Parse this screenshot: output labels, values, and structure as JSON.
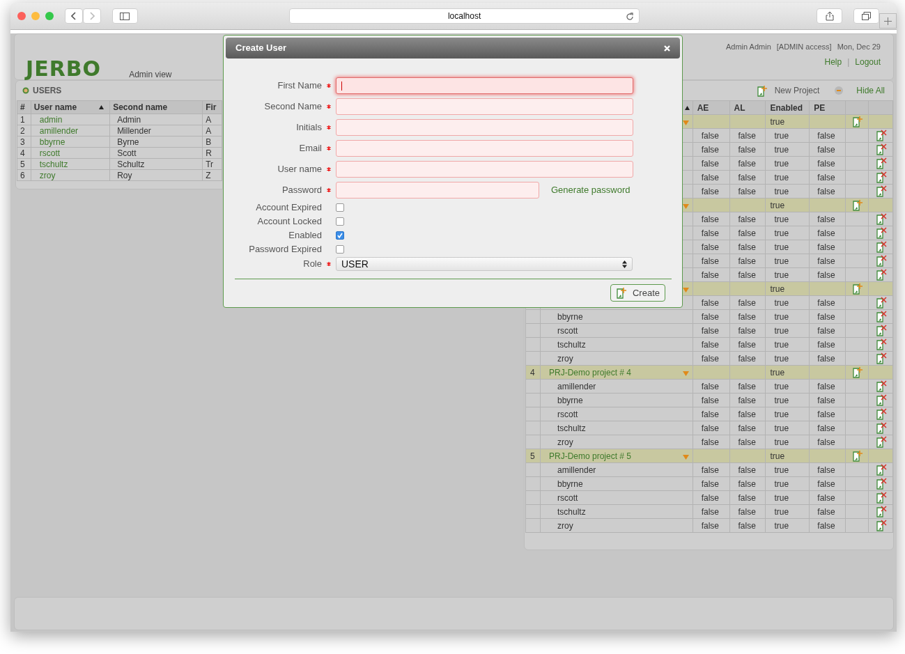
{
  "browser": {
    "url": "localhost"
  },
  "header": {
    "logo": "JERBO",
    "subtitle": "Admin view",
    "user": "Admin Admin",
    "access": "[ADMIN access]",
    "date": "Mon, Dec 29",
    "links": [
      "Help",
      "Logout"
    ],
    "separator": "|"
  },
  "users_panel": {
    "title": "USERS",
    "columns": [
      {
        "label": "#",
        "sorted": false
      },
      {
        "label": "User name",
        "sorted": true
      },
      {
        "label": "Second name",
        "sorted": false
      },
      {
        "label": "Fir",
        "sorted": false
      }
    ],
    "rows": [
      {
        "number": "1",
        "user_name": "admin",
        "second_name": "Admin",
        "column_4": "A"
      },
      {
        "number": "2",
        "user_name": "amillender",
        "second_name": "Millender",
        "column_4": "A"
      },
      {
        "number": "3",
        "user_name": "bbyrne",
        "second_name": "Byrne",
        "column_4": "B"
      },
      {
        "number": "4",
        "user_name": "rscott",
        "second_name": "Scott",
        "column_4": "R"
      },
      {
        "number": "5",
        "user_name": "tschultz",
        "second_name": "Schultz",
        "column_4": "Tr"
      },
      {
        "number": "6",
        "user_name": "zroy",
        "second_name": "Roy",
        "column_4": "Z"
      }
    ]
  },
  "projects_panel": {
    "actions": [
      {
        "kind": "add",
        "label": "New Project"
      },
      {
        "kind": "collapse",
        "label": "Hide All"
      }
    ],
    "name_column": {
      "sorted": true
    },
    "columns": [
      {
        "label": "AE"
      },
      {
        "label": "AL"
      },
      {
        "label": "Enabled"
      },
      {
        "label": "PE"
      }
    ],
    "rows": [
      {
        "kind": "project",
        "expanded": true,
        "enabled": "true"
      },
      {
        "kind": "member",
        "ae": "false",
        "al": "false",
        "enabled": "true",
        "pe": "false"
      },
      {
        "kind": "member",
        "ae": "false",
        "al": "false",
        "enabled": "true",
        "pe": "false"
      },
      {
        "kind": "member",
        "ae": "false",
        "al": "false",
        "enabled": "true",
        "pe": "false"
      },
      {
        "kind": "member",
        "ae": "false",
        "al": "false",
        "enabled": "true",
        "pe": "false"
      },
      {
        "kind": "member",
        "ae": "false",
        "al": "false",
        "enabled": "true",
        "pe": "false"
      },
      {
        "kind": "project",
        "expanded": true,
        "enabled": "true"
      },
      {
        "kind": "member",
        "ae": "false",
        "al": "false",
        "enabled": "true",
        "pe": "false"
      },
      {
        "kind": "member",
        "ae": "false",
        "al": "false",
        "enabled": "true",
        "pe": "false"
      },
      {
        "kind": "member",
        "ae": "false",
        "al": "false",
        "enabled": "true",
        "pe": "false"
      },
      {
        "kind": "member",
        "ae": "false",
        "al": "false",
        "enabled": "true",
        "pe": "false"
      },
      {
        "kind": "member",
        "ae": "false",
        "al": "false",
        "enabled": "true",
        "pe": "false"
      },
      {
        "kind": "project",
        "expanded": true,
        "enabled": "true"
      },
      {
        "kind": "member",
        "ae": "false",
        "al": "false",
        "enabled": "true",
        "pe": "false"
      },
      {
        "kind": "member",
        "name": "bbyrne",
        "ae": "false",
        "al": "false",
        "enabled": "true",
        "pe": "false"
      },
      {
        "kind": "member",
        "name": "rscott",
        "ae": "false",
        "al": "false",
        "enabled": "true",
        "pe": "false"
      },
      {
        "kind": "member",
        "name": "tschultz",
        "ae": "false",
        "al": "false",
        "enabled": "true",
        "pe": "false"
      },
      {
        "kind": "member",
        "name": "zroy",
        "ae": "false",
        "al": "false",
        "enabled": "true",
        "pe": "false"
      },
      {
        "kind": "project",
        "number": "4",
        "name": "PRJ-Demo project # 4",
        "expanded": true,
        "enabled": "true"
      },
      {
        "kind": "member",
        "name": "amillender",
        "ae": "false",
        "al": "false",
        "enabled": "true",
        "pe": "false"
      },
      {
        "kind": "member",
        "name": "bbyrne",
        "ae": "false",
        "al": "false",
        "enabled": "true",
        "pe": "false"
      },
      {
        "kind": "member",
        "name": "rscott",
        "ae": "false",
        "al": "false",
        "enabled": "true",
        "pe": "false"
      },
      {
        "kind": "member",
        "name": "tschultz",
        "ae": "false",
        "al": "false",
        "enabled": "true",
        "pe": "false"
      },
      {
        "kind": "member",
        "name": "zroy",
        "ae": "false",
        "al": "false",
        "enabled": "true",
        "pe": "false"
      },
      {
        "kind": "project",
        "number": "5",
        "name": "PRJ-Demo project # 5",
        "expanded": true,
        "enabled": "true"
      },
      {
        "kind": "member",
        "name": "amillender",
        "ae": "false",
        "al": "false",
        "enabled": "true",
        "pe": "false"
      },
      {
        "kind": "member",
        "name": "bbyrne",
        "ae": "false",
        "al": "false",
        "enabled": "true",
        "pe": "false"
      },
      {
        "kind": "member",
        "name": "rscott",
        "ae": "false",
        "al": "false",
        "enabled": "true",
        "pe": "false"
      },
      {
        "kind": "member",
        "name": "tschultz",
        "ae": "false",
        "al": "false",
        "enabled": "true",
        "pe": "false"
      },
      {
        "kind": "member",
        "name": "zroy",
        "ae": "false",
        "al": "false",
        "enabled": "true",
        "pe": "false"
      }
    ]
  },
  "dialog": {
    "title": "Create User",
    "fields": [
      {
        "kind": "text",
        "label": "First Name",
        "required": true,
        "focused": true
      },
      {
        "kind": "text",
        "label": "Second Name",
        "required": true,
        "focused": false
      },
      {
        "kind": "text",
        "label": "Initials",
        "required": true,
        "focused": false
      },
      {
        "kind": "text",
        "label": "Email",
        "required": true,
        "focused": false
      },
      {
        "kind": "text",
        "label": "User name",
        "required": true,
        "focused": false
      },
      {
        "kind": "password",
        "label": "Password",
        "required": true,
        "focused": false,
        "action": "Generate password"
      },
      {
        "kind": "checkbox",
        "label": "Account Expired",
        "checked": false
      },
      {
        "kind": "checkbox",
        "label": "Account Locked",
        "checked": false
      },
      {
        "kind": "checkbox",
        "label": "Enabled",
        "checked": true
      },
      {
        "kind": "checkbox",
        "label": "Password Expired",
        "checked": false
      },
      {
        "kind": "select",
        "label": "Role",
        "required": true,
        "value": "USER"
      }
    ],
    "submit": "Create"
  }
}
